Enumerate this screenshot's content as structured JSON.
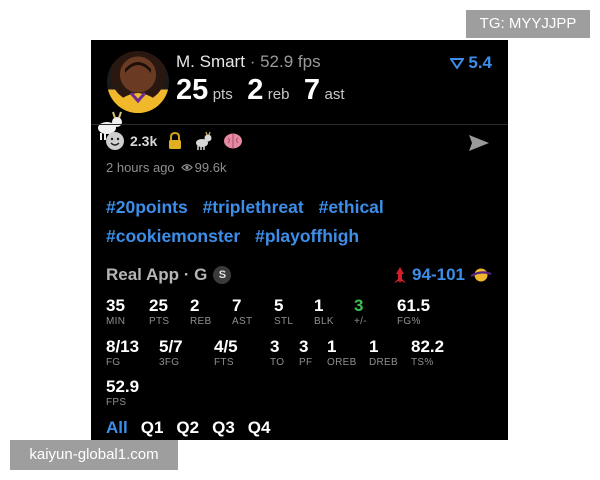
{
  "watermark_top": "TG: MYYJJPP",
  "watermark_bottom": "kaiyun-global1.com",
  "header": {
    "player": "M. Smart",
    "separator": "·",
    "fps_label": "52.9 fps",
    "score_value": "5.4",
    "points": "25",
    "points_unit": "pts",
    "rebounds": "2",
    "rebounds_unit": "reb",
    "assists": "7",
    "assists_unit": "ast"
  },
  "reactions": {
    "count": "2.3k"
  },
  "meta": {
    "time": "2 hours ago",
    "views": "99.6k"
  },
  "tags": [
    "#20points",
    "#triplethreat",
    "#ethical",
    "#cookiemonster",
    "#playoffhigh"
  ],
  "game": {
    "label": "Real App · G",
    "badge": "S",
    "away_score": "94",
    "dash": "-",
    "home_score": "101"
  },
  "stats_row1": [
    {
      "value": "35",
      "label": "MIN"
    },
    {
      "value": "25",
      "label": "PTS"
    },
    {
      "value": "2",
      "label": "REB"
    },
    {
      "value": "7",
      "label": "AST"
    },
    {
      "value": "5",
      "label": "STL"
    },
    {
      "value": "1",
      "label": "BLK"
    },
    {
      "value": "3",
      "label": "+/-"
    },
    {
      "value": "61.5",
      "label": "FG%"
    }
  ],
  "stats_row2": [
    {
      "value": "8/13",
      "label": "FG"
    },
    {
      "value": "5/7",
      "label": "3FG"
    },
    {
      "value": "4/5",
      "label": "FTS"
    },
    {
      "value": "3",
      "label": "TO"
    },
    {
      "value": "3",
      "label": "PF"
    },
    {
      "value": "1",
      "label": "OREB"
    },
    {
      "value": "1",
      "label": "DREB"
    },
    {
      "value": "82.2",
      "label": "TS%"
    }
  ],
  "stats_row3": [
    {
      "value": "52.9",
      "label": "FPS"
    }
  ],
  "quarters": [
    "All",
    "Q1",
    "Q2",
    "Q3",
    "Q4"
  ],
  "colors": {
    "accent": "#3d8ee8",
    "positive": "#3fbf4f",
    "background": "#000000"
  }
}
